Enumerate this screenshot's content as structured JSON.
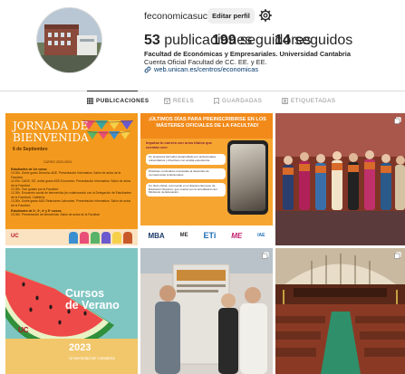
{
  "profile": {
    "username": "feconomicasuc",
    "edit_label": "Editar perfil",
    "posts_count": "53",
    "posts_label": "publicaciones",
    "followers_count": "199",
    "followers_label": "seguidores",
    "following_count": "14",
    "following_label": "seguidos",
    "bio_name": "Facultad de Económicas y Empresariales. Universidad Cantabria",
    "bio_line": "Cuenta Oficial Facultad de CC. EE. y EE.",
    "link": "web.unican.es/centros/economicas"
  },
  "tabs": [
    {
      "label": "PUBLICACIONES",
      "icon": "grid-icon"
    },
    {
      "label": "REELS",
      "icon": "reels-icon"
    },
    {
      "label": "GUARDADAS",
      "icon": "bookmark-icon"
    },
    {
      "label": "ETIQUETADAS",
      "icon": "tag-icon"
    }
  ],
  "posts": {
    "p1": {
      "title1": "JORNADA DE",
      "title2": "BIENVENIDA",
      "date": "6 de Septiembre",
      "course": "CURSO 2023-2024",
      "lines": [
        "Estudiantes de 1er curso:",
        "10.00h. Doble grado Derecho-ADE. Presentación Informativa. Salón de actos de la Facultad.",
        "11.00h. CADE, GE, doble grado ADE-Economía. Presentación Informativa. Salón de actos de la Facultad.",
        "12.00h. Tour guiado por la Facultad.",
        "12.30h. Encuentro social de bienvenida (en colaboración con la Delegación de Estudiantes de la Facultad). Cafetería.",
        "13.30h. Doble grado ADE-Relaciones Laborales. Presentación Informativa. Salón de actos de la Facultad.",
        "Estudiantes de 2º, 3º, 4º y 5º cursos",
        "10.00h. Presentación de bienvenida. Salón de actos de la Facultad"
      ]
    },
    "p2": {
      "header": "¡ÚLTIMOS DÍAS PARA PREINSCRIBIRSE EN LOS MÁSTERES OFICIALES DE LA FACULTAD!",
      "lead": "Impulsa tu carrera con unos títulos que cuentan con:",
      "items": [
        "Un programa formativo desarrollado por profesionales universitarios y directivos con amplia experiencia.",
        "Prácticas curriculares orientadas al desarrollo de competencias profesionales.",
        "Un título oficial, reconocido en el Espacio Europeo de Educación Superior, que cuenta con la acreditación del Ministerio de Educación."
      ],
      "logos": [
        "MBA",
        "ME",
        "ETi",
        "ME",
        "IAE"
      ]
    },
    "p4": {
      "title1": "Cursos",
      "title2": "de Verano",
      "year": "2023",
      "org": "Universidad de Cantabria",
      "logo": "UC"
    }
  },
  "colors": {
    "accent_link": "#00376b",
    "p1_bg": "#f39a1e",
    "p2_bg": "#f7a531",
    "p4_bg": "#7fc6c2"
  }
}
